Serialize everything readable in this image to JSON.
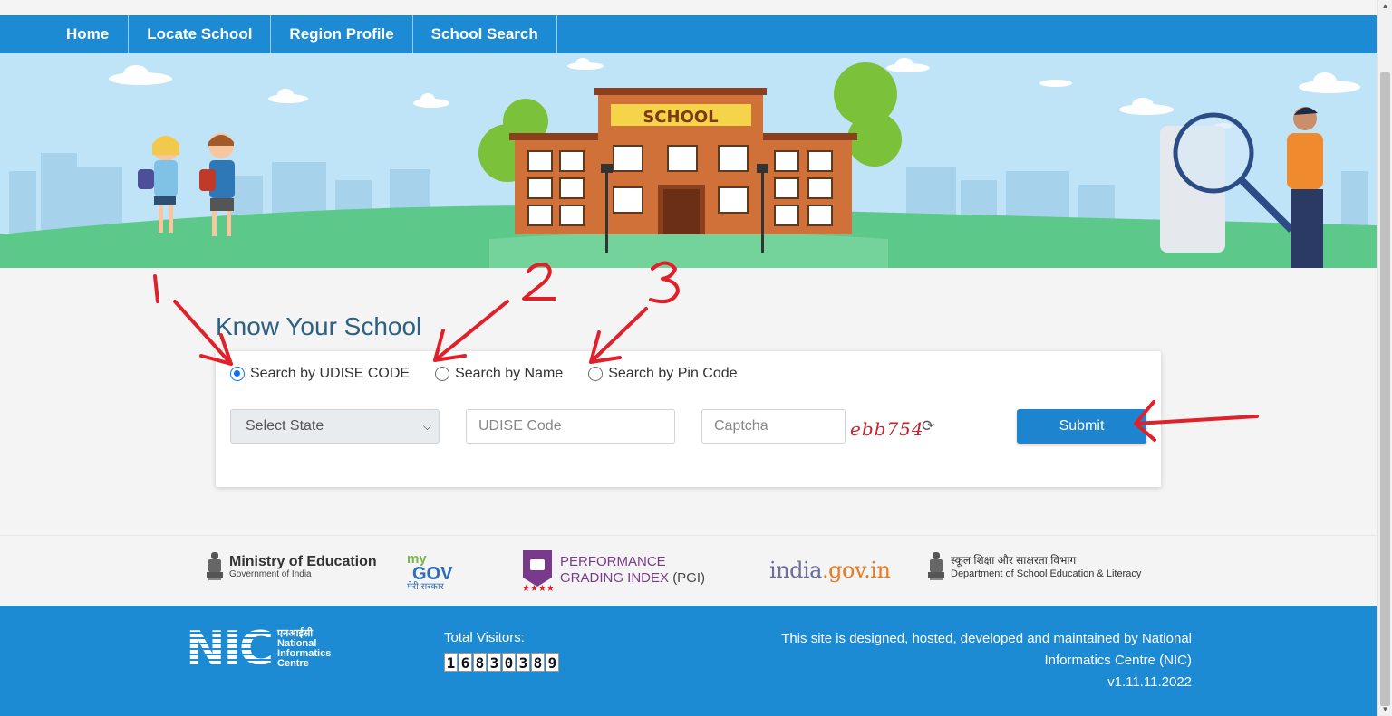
{
  "nav": {
    "items": [
      {
        "label": "Home"
      },
      {
        "label": "Locate School"
      },
      {
        "label": "Region Profile"
      },
      {
        "label": "School Search"
      }
    ]
  },
  "banner": {
    "school_sign": "SCHOOL"
  },
  "main": {
    "title": "Know Your School",
    "search_options": [
      {
        "label": "Search by UDISE CODE",
        "checked": true
      },
      {
        "label": "Search by Name",
        "checked": false
      },
      {
        "label": "Search by Pin Code",
        "checked": false
      }
    ],
    "state_select": {
      "value": "Select State"
    },
    "udise_input": {
      "placeholder": "UDISE Code"
    },
    "captcha_input": {
      "placeholder": "Captcha"
    },
    "captcha_text": "ebb754",
    "refresh_icon": "refresh-icon",
    "submit_label": "Submit"
  },
  "annotations": {
    "numbers": [
      "1",
      "2",
      "3"
    ],
    "color": "#e0202a"
  },
  "partners": {
    "moe": {
      "title": "Ministry of Education",
      "subtitle": "Government of India"
    },
    "mygov": {
      "my": "my",
      "gov": "GOV",
      "hindi": "मेरी सरकार"
    },
    "pgi": {
      "line1": "PERFORMANCE",
      "line2": "GRADING INDEX",
      "abbr": "(PGI)"
    },
    "india_gov": {
      "prefix": "india",
      "suffix": ".gov.in"
    },
    "dsel": {
      "hindi": "स्कूल शिक्षा और साक्षरता विभाग",
      "english": "Department of School Education & Literacy"
    }
  },
  "footer": {
    "nic_big": "NIC",
    "nic_hindi": "एनआईसी",
    "nic_line1": "National",
    "nic_line2": "Informatics",
    "nic_line3": "Centre",
    "visitors_label": "Total Visitors:",
    "visitor_digits": [
      "1",
      "6",
      "8",
      "3",
      "0",
      "3",
      "8",
      "9"
    ],
    "credit_line1": "This site is designed, hosted, developed and maintained by National",
    "credit_line2": "Informatics Centre (NIC)",
    "version": "v1.11.11.2022"
  },
  "colors": {
    "nav_bg": "#1d8ad4",
    "title": "#2b6183",
    "submit": "#1d84cf",
    "annotation_red": "#e0202a"
  }
}
